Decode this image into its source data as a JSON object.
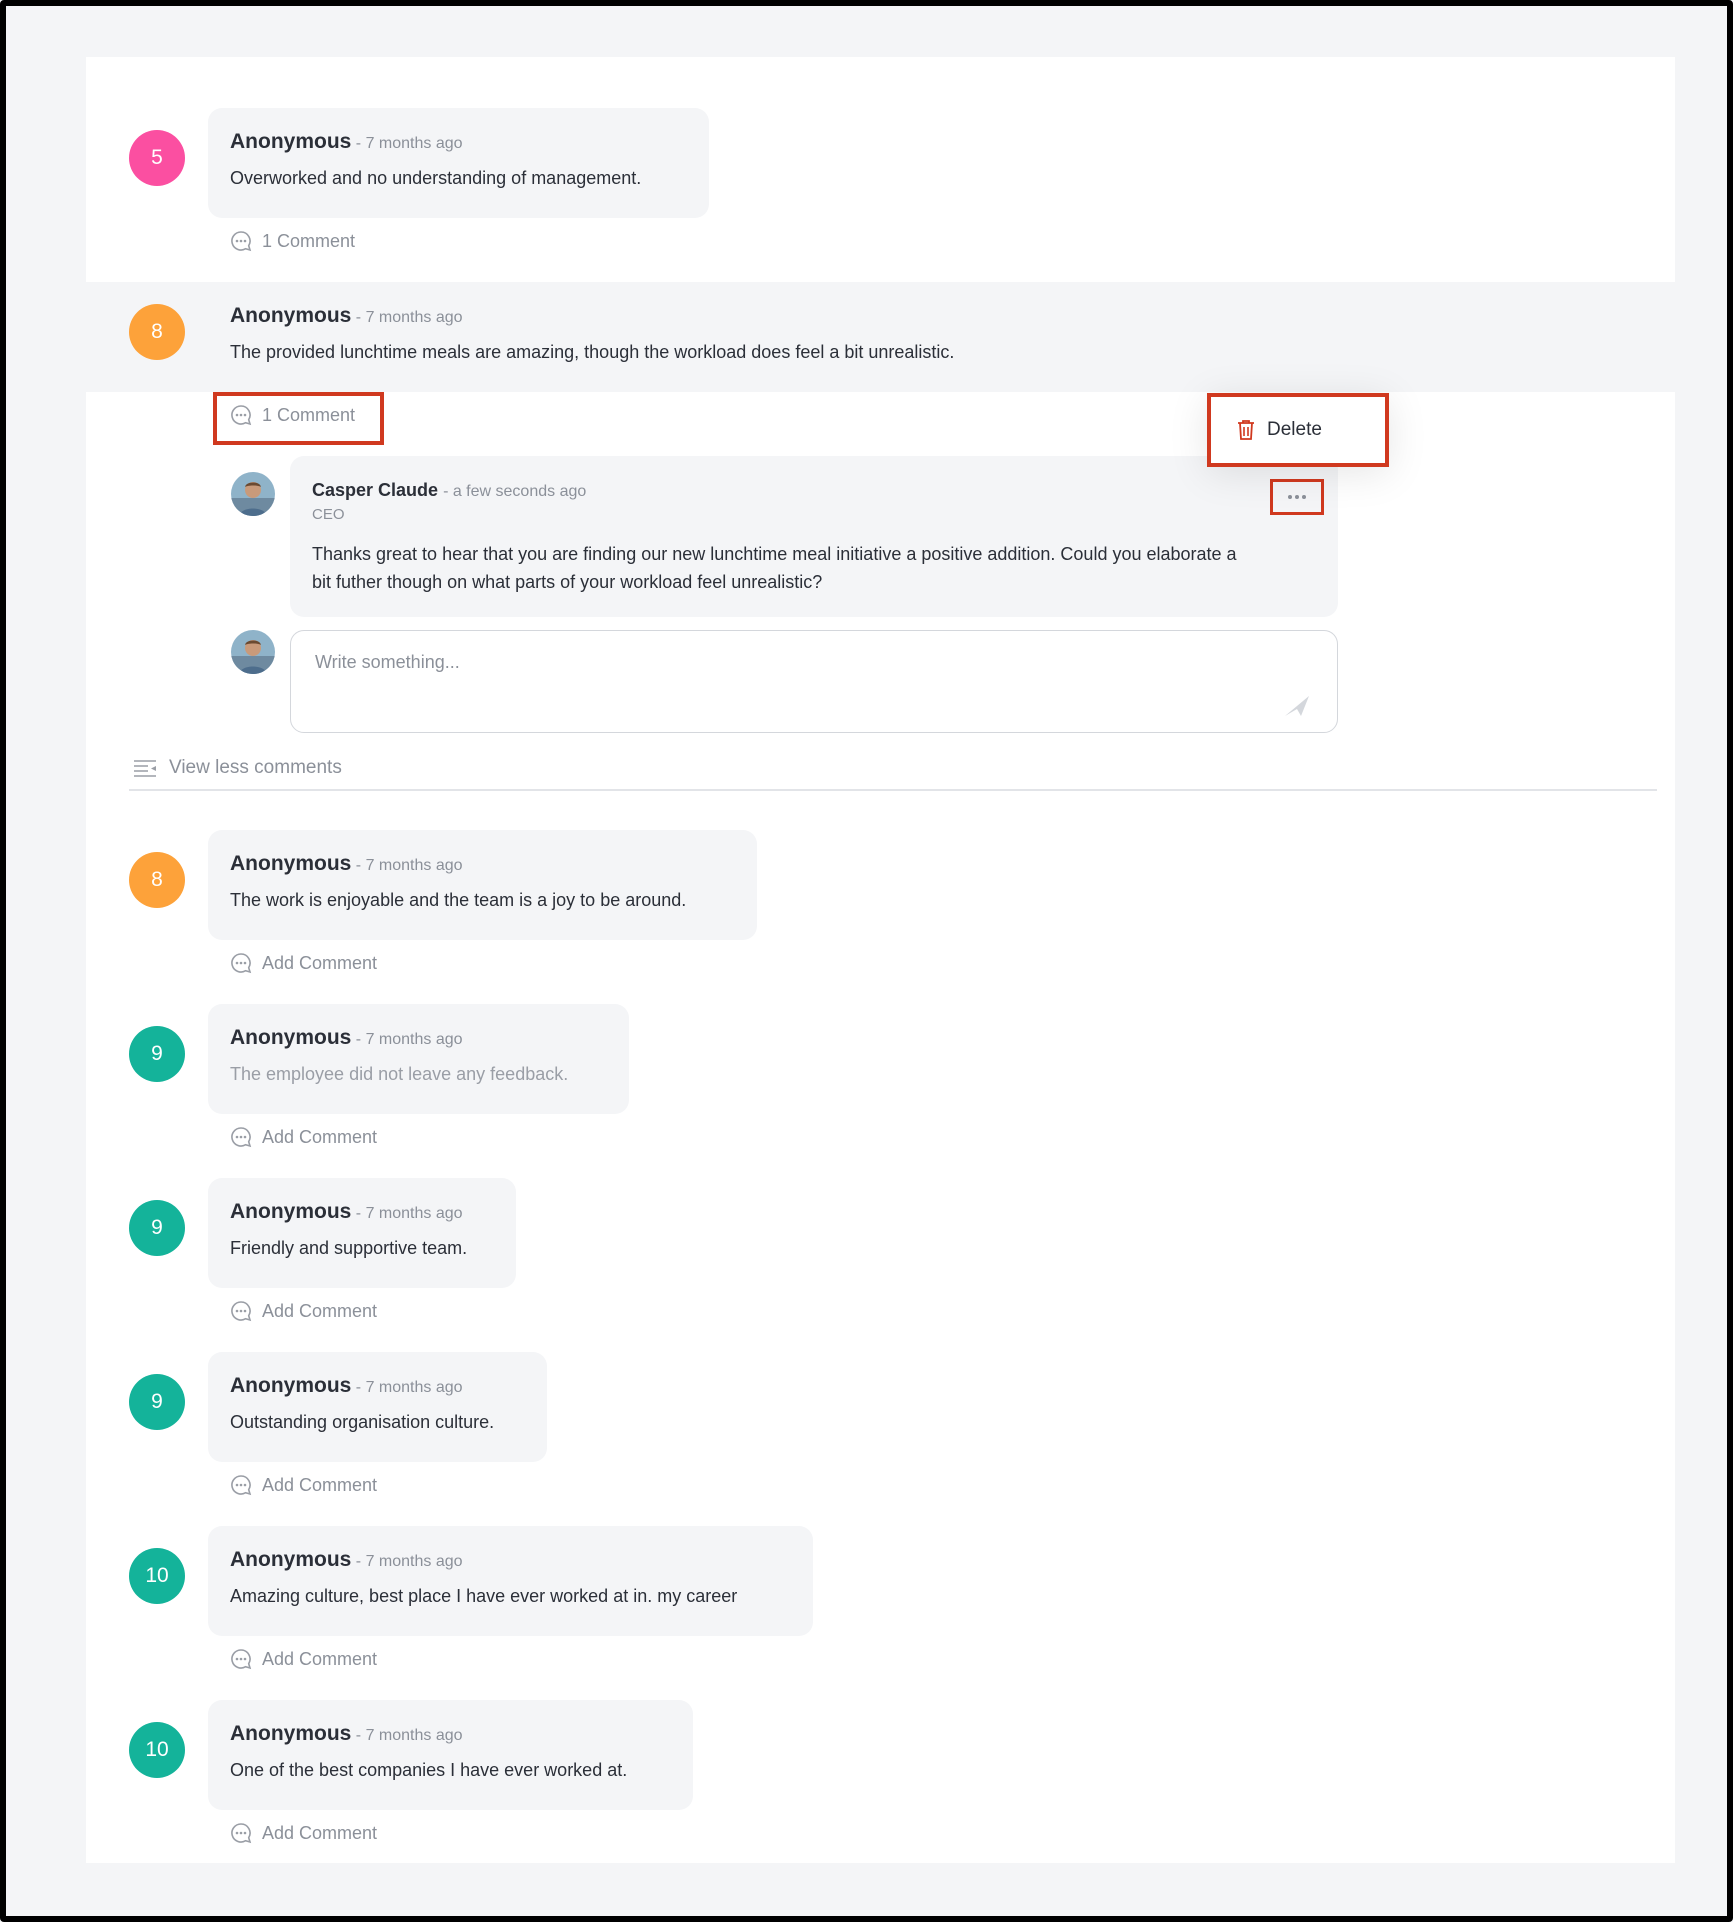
{
  "colors": {
    "pink": "#fb4fa1",
    "orange": "#fda23a",
    "teal": "#14b39a",
    "highlight": "#d0391f"
  },
  "responses": [
    {
      "score": "5",
      "color": "#fb4fa1",
      "author": "Anonymous",
      "time": "- 7 months ago",
      "text": "Overworked and no understanding of management.",
      "action": "1 Comment"
    },
    {
      "score": "8",
      "color": "#fda23a",
      "author": "Anonymous",
      "time": "- 7 months ago",
      "text": "The provided lunchtime meals are amazing, though the workload does feel a bit unrealistic.",
      "action": "1 Comment"
    },
    {
      "score": "8",
      "color": "#fda23a",
      "author": "Anonymous",
      "time": "- 7 months ago",
      "text": "The work is enjoyable and the team is a joy to be around.",
      "action": "Add Comment"
    },
    {
      "score": "9",
      "color": "#14b39a",
      "author": "Anonymous",
      "time": "- 7 months ago",
      "text": "The employee did not leave any feedback.",
      "action": "Add Comment"
    },
    {
      "score": "9",
      "color": "#14b39a",
      "author": "Anonymous",
      "time": "- 7 months ago",
      "text": "Friendly and supportive team.",
      "action": "Add Comment"
    },
    {
      "score": "9",
      "color": "#14b39a",
      "author": "Anonymous",
      "time": "- 7 months ago",
      "text": "Outstanding organisation culture.",
      "action": "Add Comment"
    },
    {
      "score": "10",
      "color": "#14b39a",
      "author": "Anonymous",
      "time": "- 7 months ago",
      "text": "Amazing culture, best place I have ever worked at in. my career",
      "action": "Add Comment"
    },
    {
      "score": "10",
      "color": "#14b39a",
      "author": "Anonymous",
      "time": "- 7 months ago",
      "text": "One of the best companies I have ever worked at.",
      "action": "Add Comment"
    }
  ],
  "reply": {
    "name": "Casper Claude",
    "time": "- a few seconds ago",
    "role": "CEO",
    "text": "Thanks great to hear that you are finding our new lunchtime meal initiative a positive addition. Could you elaborate a bit futher though on what parts of your workload feel unrealistic?"
  },
  "context_menu": {
    "delete_label": "Delete"
  },
  "composer": {
    "placeholder": "Write something..."
  },
  "view_less_label": "View less comments",
  "icons": {
    "comment": "comment-icon",
    "trash": "trash-icon",
    "more": "more-icon",
    "send": "send-icon",
    "view_less": "view-less-icon"
  }
}
